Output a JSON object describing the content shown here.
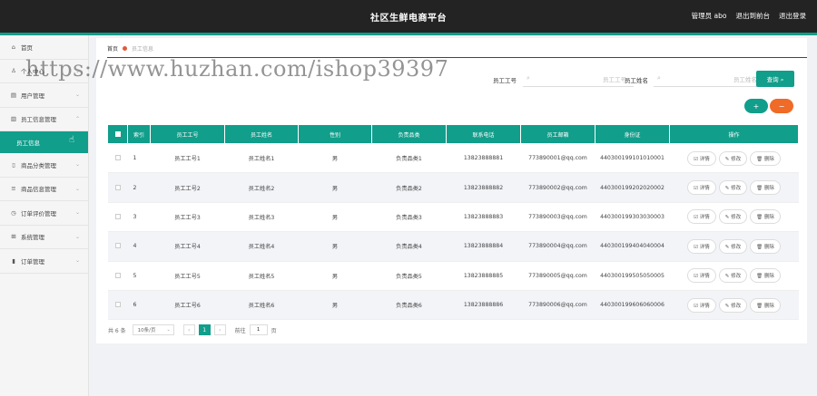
{
  "header": {
    "title": "社区生鲜电商平台",
    "admin": "管理员 abo",
    "to_frontend": "退出到前台",
    "logout": "退出登录"
  },
  "sidebar": {
    "items": [
      {
        "label": "首页",
        "icon": "home-icon",
        "glyph": "⌂"
      },
      {
        "label": "个人中心",
        "icon": "user-icon",
        "glyph": "♙",
        "chev": "⌄"
      },
      {
        "label": "用户管理",
        "icon": "list-icon",
        "glyph": "▤",
        "chev": "⌄"
      },
      {
        "label": "员工信息管理",
        "icon": "chart-icon",
        "glyph": "▥",
        "chev": "⌃"
      },
      {
        "label": "员工信息",
        "icon": "",
        "glyph": ""
      },
      {
        "label": "商品分类管理",
        "icon": "doc-icon",
        "glyph": "▯",
        "chev": "⌄"
      },
      {
        "label": "商品信息管理",
        "icon": "menu-icon",
        "glyph": "≡",
        "chev": "⌄"
      },
      {
        "label": "订单评价管理",
        "icon": "clock-icon",
        "glyph": "◷",
        "chev": "⌄"
      },
      {
        "label": "系统管理",
        "icon": "grid-icon",
        "glyph": "⊞",
        "chev": "⌄"
      },
      {
        "label": "订单管理",
        "icon": "bar-icon",
        "glyph": "▮",
        "chev": "⌄"
      }
    ]
  },
  "breadcrumb": {
    "home": "首页",
    "current": "员工信息"
  },
  "search": {
    "label1": "员工工号",
    "placeholder1": "员工工号",
    "label2": "员工姓名",
    "placeholder2": "员工姓名",
    "button": "查询 ⌕"
  },
  "actions": {
    "add": "+",
    "delete": "−"
  },
  "table": {
    "headers": [
      "索引",
      "员工工号",
      "员工姓名",
      "性别",
      "负责品类",
      "联系电话",
      "员工邮箱",
      "身份证",
      "操作"
    ],
    "rows": [
      [
        "1",
        "员工工号1",
        "员工姓名1",
        "男",
        "负责品类1",
        "13823888881",
        "773890001@qq.com",
        "440300199101010001"
      ],
      [
        "2",
        "员工工号2",
        "员工姓名2",
        "男",
        "负责品类2",
        "13823888882",
        "773890002@qq.com",
        "440300199202020002"
      ],
      [
        "3",
        "员工工号3",
        "员工姓名3",
        "男",
        "负责品类3",
        "13823888883",
        "773890003@qq.com",
        "440300199303030003"
      ],
      [
        "4",
        "员工工号4",
        "员工姓名4",
        "男",
        "负责品类4",
        "13823888884",
        "773890004@qq.com",
        "440300199404040004"
      ],
      [
        "5",
        "员工工号5",
        "员工姓名5",
        "男",
        "负责品类5",
        "13823888885",
        "773890005@qq.com",
        "440300199505050005"
      ],
      [
        "6",
        "员工工号6",
        "员工姓名6",
        "男",
        "负责品类6",
        "13823888886",
        "773890006@qq.com",
        "440300199606060006"
      ]
    ],
    "ops": [
      "☑ 详情",
      "✎ 修改",
      "🗑 删除"
    ]
  },
  "pager": {
    "total": "共 6 条",
    "size": "10条/页",
    "prev": "‹",
    "page": "1",
    "next": "›",
    "goto_prefix": "前往",
    "goto_value": "1",
    "goto_suffix": "页"
  },
  "watermark": "https://www.huzhan.com/ishop39397",
  "colors": {
    "accent": "#119e8b",
    "danger": "#f06a28",
    "header": "#232323"
  }
}
